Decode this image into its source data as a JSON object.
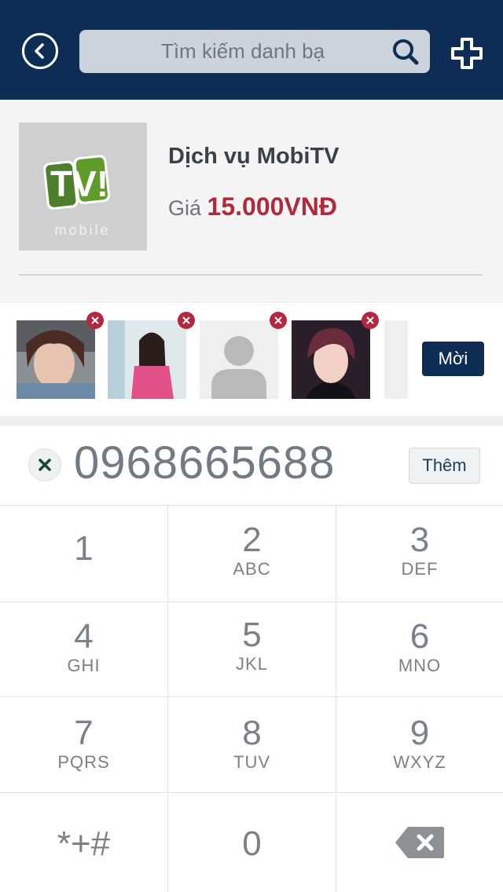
{
  "header": {
    "search_placeholder": "Tìm kiếm danh bạ",
    "bg_color": "#0d2d54"
  },
  "product": {
    "logo_text_top": "TV!",
    "logo_text_bottom": "mobile",
    "name": "Dịch vụ MobiTV",
    "price_label": "Giá",
    "price_value": "15.000VNĐ"
  },
  "invitees": {
    "items": [
      {
        "type": "photo",
        "icon": "girl-photo-1"
      },
      {
        "type": "photo",
        "icon": "girl-photo-2"
      },
      {
        "type": "placeholder",
        "icon": "person-placeholder-icon"
      },
      {
        "type": "photo",
        "icon": "girl-photo-3"
      }
    ],
    "invite_label": "Mời"
  },
  "dial": {
    "number": "0968665688",
    "add_label": "Thêm"
  },
  "keypad": {
    "keys": [
      {
        "digit": "1",
        "letters": ""
      },
      {
        "digit": "2",
        "letters": "ABC"
      },
      {
        "digit": "3",
        "letters": "DEF"
      },
      {
        "digit": "4",
        "letters": "GHI"
      },
      {
        "digit": "5",
        "letters": "JKL"
      },
      {
        "digit": "6",
        "letters": "MNO"
      },
      {
        "digit": "7",
        "letters": "PQRS"
      },
      {
        "digit": "8",
        "letters": "TUV"
      },
      {
        "digit": "9",
        "letters": "WXYZ"
      },
      {
        "digit": "*+#",
        "letters": ""
      },
      {
        "digit": "0",
        "letters": ""
      },
      {
        "digit": "",
        "letters": "",
        "icon": "backspace-icon"
      }
    ]
  },
  "colors": {
    "accent_navy": "#0d2d54",
    "price_red": "#b02a3c",
    "remove_red": "#b3283e"
  }
}
